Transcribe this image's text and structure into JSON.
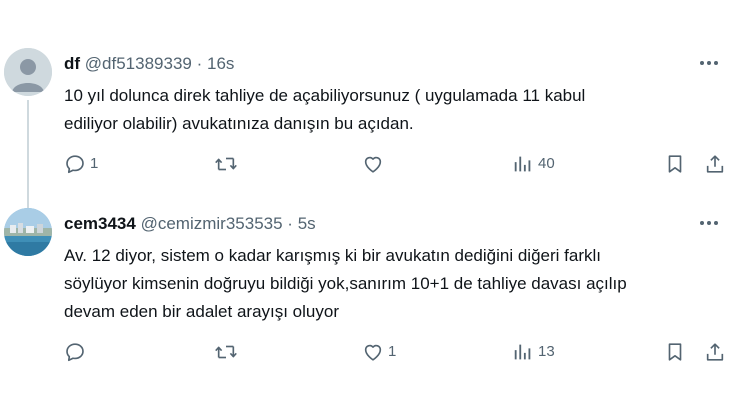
{
  "tweets": [
    {
      "display_name": "df",
      "handle": "@df51389339",
      "separator": "·",
      "time": "16s",
      "text_lines": [
        "10 yıl dolunca direk tahliye de açabiliyorsunuz ( uygulamada 11 kabul",
        "ediliyor olabilir) avukatınıza danışın bu açıdan."
      ],
      "reply_count": "1",
      "retweet_count": "",
      "like_count": "",
      "view_count": "40",
      "avatar": "default-avatar-icon"
    },
    {
      "display_name": "cem3434",
      "handle": "@cemizmir353535",
      "separator": "·",
      "time": "5s",
      "text_lines": [
        "Av. 12 diyor, sistem o kadar karışmış ki bir avukatın dediğini diğeri farklı",
        "söylüyor kimsenin doğruyu bildiği yok,sanırım 10+1 de tahliye davası açılıp",
        "devam eden bir adalet arayışı oluyor"
      ],
      "reply_count": "",
      "retweet_count": "",
      "like_count": "1",
      "view_count": "13",
      "avatar": "seaside-city-photo"
    }
  ],
  "icons": {
    "reply": "reply-icon",
    "retweet": "retweet-icon",
    "like": "heart-icon",
    "views": "views-chart-icon",
    "bookmark": "bookmark-icon",
    "share": "share-icon",
    "more": "more-options-icon"
  },
  "colors": {
    "text": "#0f1419",
    "secondary": "#536471",
    "thread_line": "#cfd9de"
  }
}
